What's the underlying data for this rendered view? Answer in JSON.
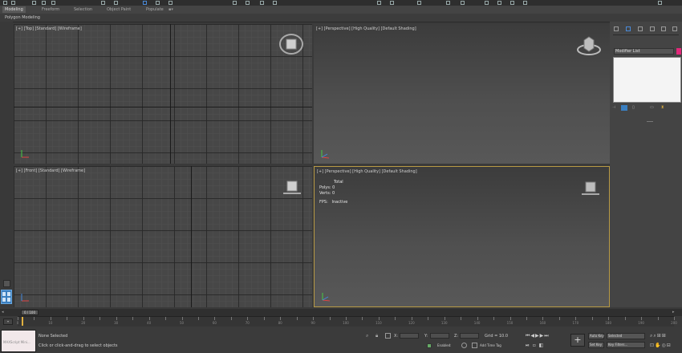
{
  "ribbon": {
    "tabs": [
      "Modeling",
      "Freeform",
      "Selection",
      "Object Paint",
      "Populate"
    ],
    "active_tab": "Modeling",
    "subtitle": "Polygon Modeling"
  },
  "viewports": {
    "top": {
      "label": "[+] [Top] [Standard] [Wireframe]"
    },
    "persp_top": {
      "label": "[+] [Perspective] [High Quality] [Default Shading]"
    },
    "front": {
      "label": "[+] [Front] [Standard] [Wireframe]"
    },
    "persp_active": {
      "label": "[+] [Perspective] [High Quality] [Default Shading]",
      "stats": {
        "header": "Total",
        "polys_label": "Polys:",
        "polys_value": "0",
        "verts_label": "Verts:",
        "verts_value": "0",
        "fps_label": "FPS:",
        "fps_value": "Inactive"
      }
    }
  },
  "command_panel": {
    "modifier_list": "Modifier List",
    "accent_color": "#e2287a"
  },
  "timeline": {
    "frame_counter": "0 / 100",
    "ticks": [
      "0",
      "5",
      "10",
      "15",
      "20",
      "25",
      "30",
      "35",
      "40",
      "45",
      "50",
      "55",
      "60",
      "65",
      "70",
      "75",
      "80",
      "85",
      "90",
      "95",
      "100",
      "105",
      "110",
      "115",
      "120",
      "125",
      "130",
      "135",
      "140",
      "145",
      "150",
      "155",
      "160",
      "165",
      "170",
      "175",
      "180",
      "185",
      "190",
      "195",
      "200"
    ]
  },
  "status": {
    "maxscript_hint": "MAXScript Mini...",
    "selection": "None Selected",
    "prompt": "Click or click-and-drag to select objects",
    "x_label": "X:",
    "y_label": "Y:",
    "z_label": "Z:",
    "grid": "Grid = 10.0",
    "enabled_label": "Enabled:",
    "add_time_tag": "Add Time Tag",
    "autokey": "Auto Key",
    "setkey": "Set Key",
    "selected": "Selected",
    "key_filters": "Key Filters..."
  }
}
